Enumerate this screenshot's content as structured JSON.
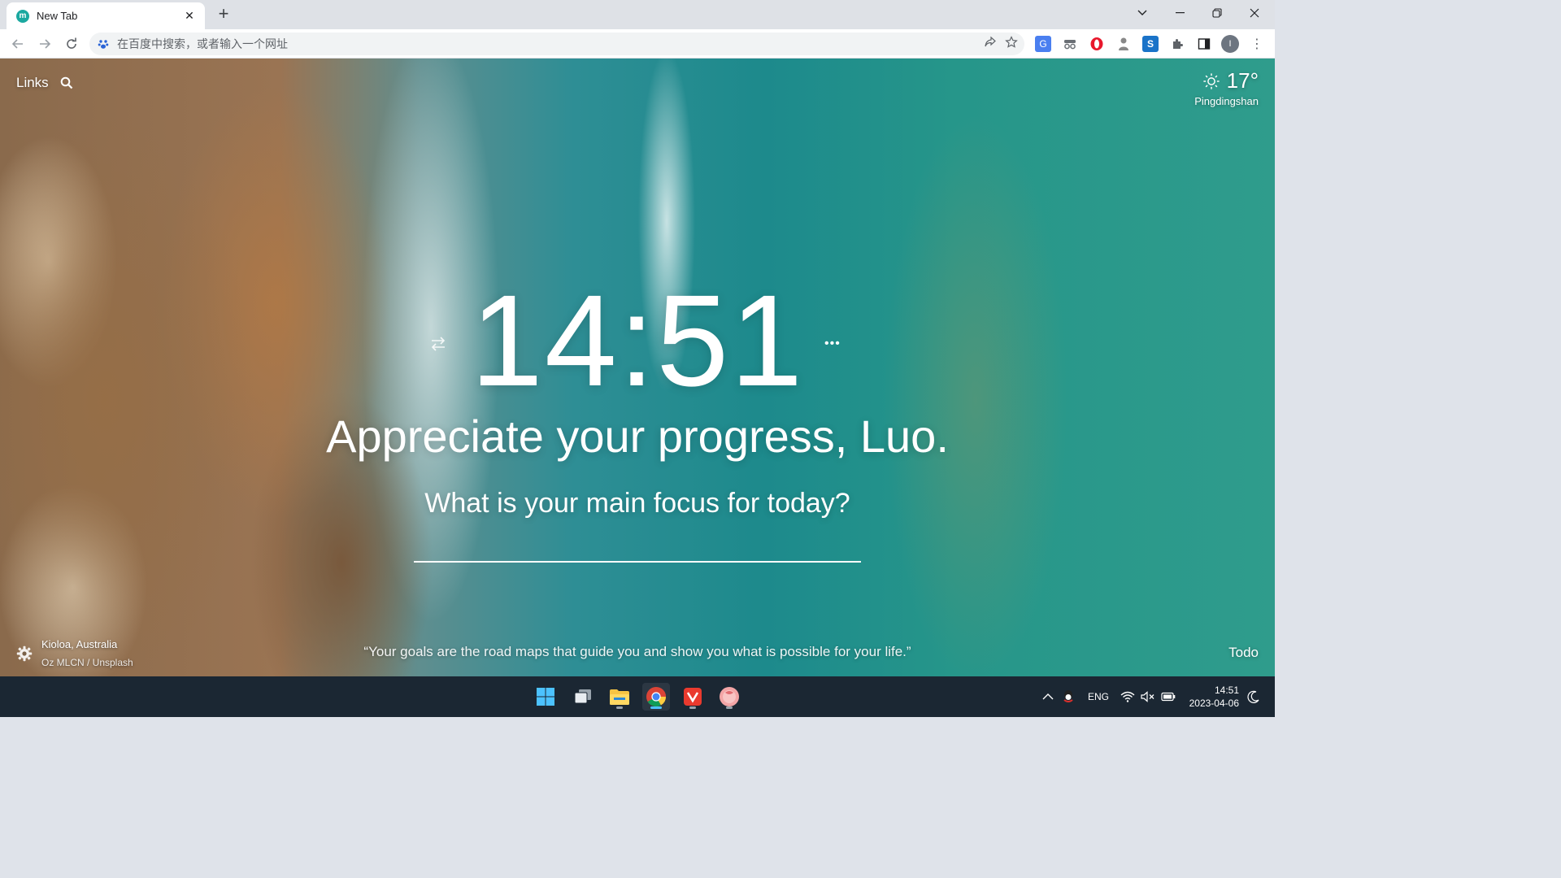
{
  "browser": {
    "tab_title": "New Tab",
    "favicon_letter": "m",
    "address_placeholder": "在百度中搜索，或者输入一个网址",
    "profile_initial": "I"
  },
  "page": {
    "links_label": "Links",
    "weather": {
      "temperature": "17°",
      "city": "Pingdingshan"
    },
    "clock": "14:51",
    "greeting": "Appreciate your progress, Luo.",
    "focus_question": "What is your main focus for today?",
    "focus_value": "",
    "photo_location": "Kioloa, Australia",
    "photo_credit": "Oz MLCN / Unsplash",
    "quote": "“Your goals are the road maps that guide you and show you what is possible for your life.”",
    "todo_label": "Todo"
  },
  "taskbar": {
    "apps": [
      "windows-start",
      "task-view",
      "file-explorer",
      "chrome",
      "wps-office",
      "app-pink"
    ],
    "active_app": "chrome",
    "language": "ENG",
    "time": "14:51",
    "date": "2023-04-06"
  },
  "colors": {
    "tab_strip": "#dee1e6",
    "taskbar": "#1b2733",
    "accent": "#4cc2ff"
  }
}
